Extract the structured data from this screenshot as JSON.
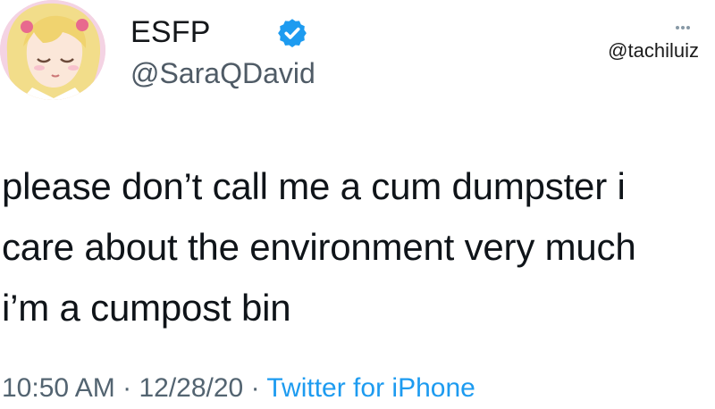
{
  "tweet": {
    "display_name": "ESFP",
    "handle": "@SaraQDavid",
    "watermark": "@tachiluiz",
    "text_lines": [
      "please don’t call me a cum dumpster i",
      "care about the environment very much",
      "i’m a cumpost bin"
    ],
    "time": "10:50 AM",
    "separator": "·",
    "date": "12/28/20",
    "source": "Twitter for iPhone"
  },
  "icons": {
    "avatar": "anime-character-avatar",
    "verified": "verified-badge-icon",
    "more": "more-options-icon"
  },
  "colors": {
    "verified_blue": "#1d9bf0",
    "secondary_text": "#536471",
    "primary_text": "#0f1419"
  }
}
